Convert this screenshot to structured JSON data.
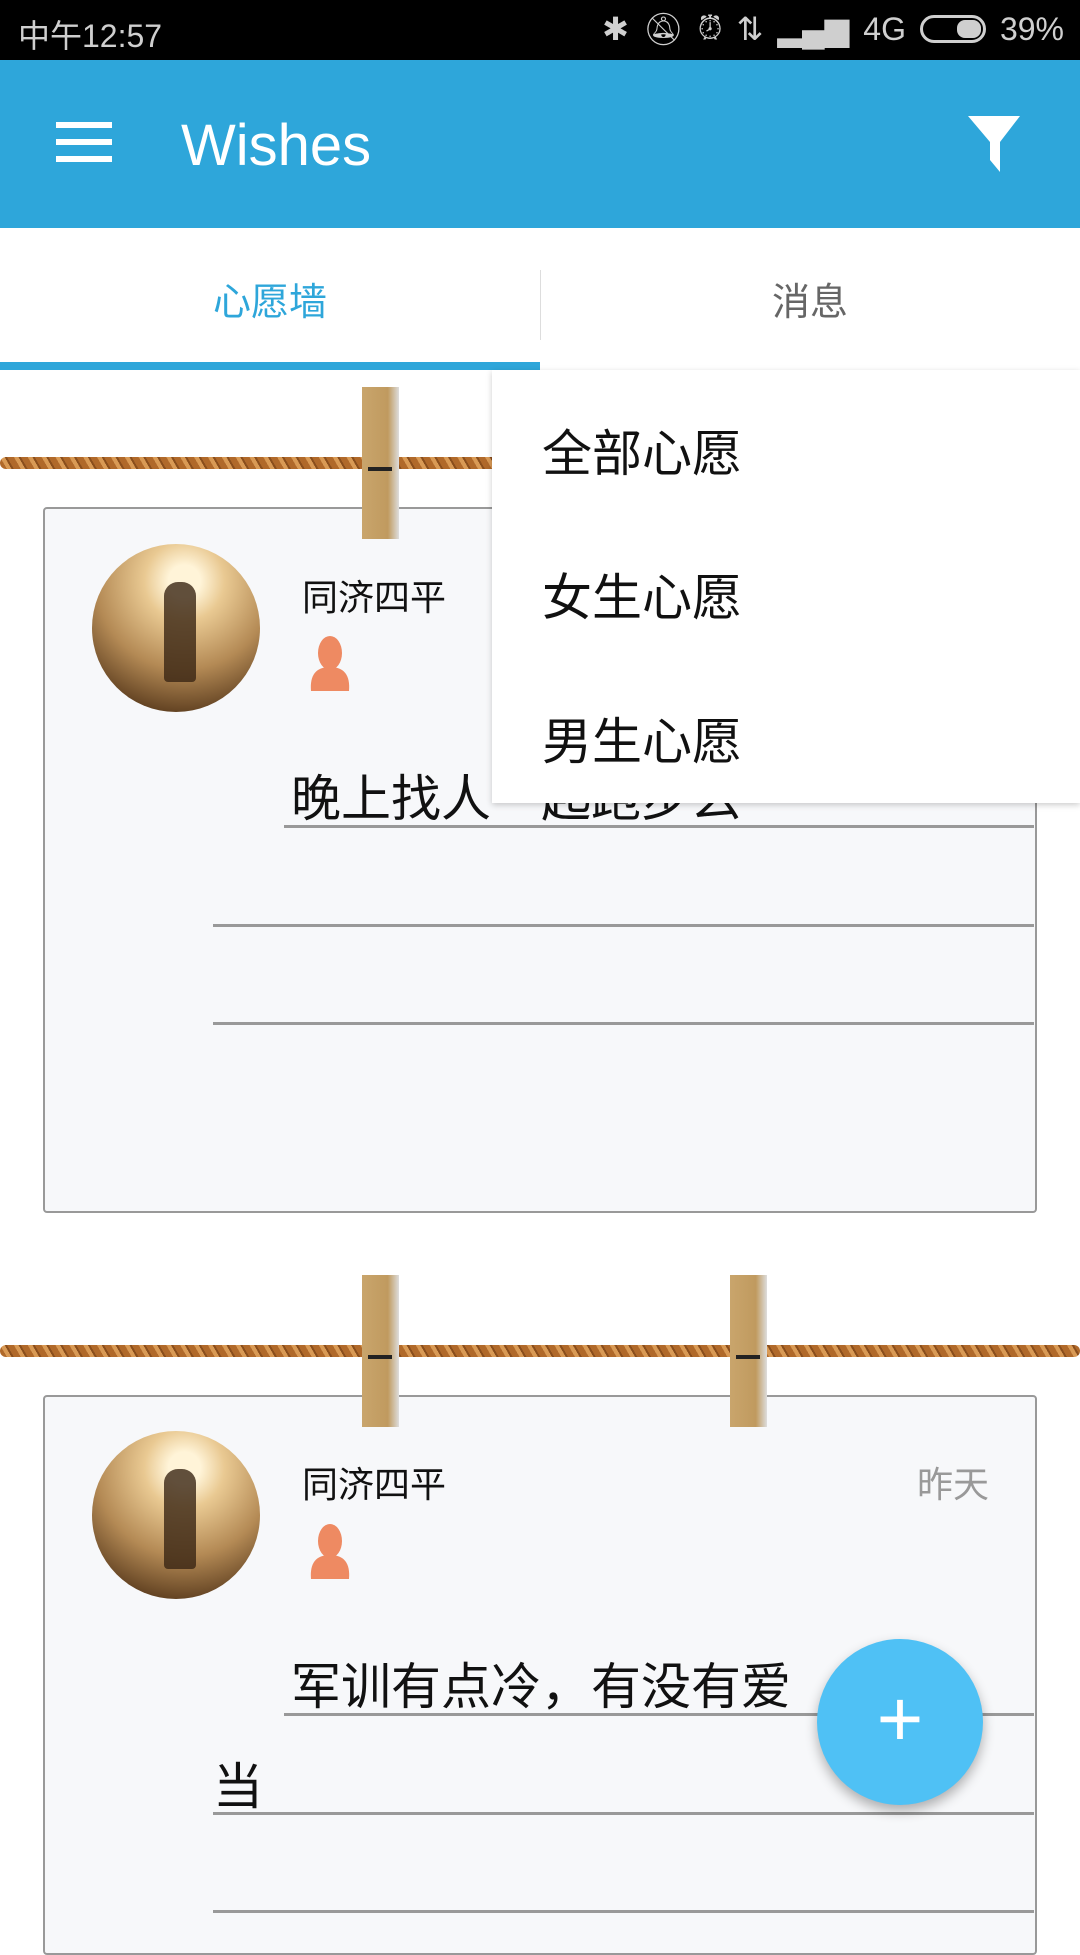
{
  "status_bar": {
    "time": "中午12:57",
    "network": "4G",
    "battery": "39%",
    "battery_level": 0.39,
    "icons": [
      "bluetooth-icon",
      "vibrate-icon",
      "alarm-icon",
      "data-icon",
      "signal-icon"
    ]
  },
  "app_bar": {
    "title": "Wishes",
    "menu_icon": "hamburger-icon",
    "filter_icon": "filter-icon"
  },
  "tabs": [
    {
      "label": "心愿墙",
      "active": true
    },
    {
      "label": "消息",
      "active": false
    }
  ],
  "colors": {
    "primary": "#2ea6da",
    "fab": "#4fc1f5",
    "gender_female": "#ee8a62"
  },
  "filter_menu": {
    "items": [
      "全部心愿",
      "女生心愿",
      "男生心愿"
    ]
  },
  "cards": [
    {
      "user": "同济四平",
      "date": "",
      "gender": "female",
      "lines": [
        "晚上找人一起跑步么",
        "",
        ""
      ]
    },
    {
      "user": "同济四平",
      "date": "昨天",
      "gender": "female",
      "lines": [
        "军训有点冷，有没有爱",
        "当",
        ""
      ]
    }
  ],
  "fab": {
    "label": "+"
  }
}
